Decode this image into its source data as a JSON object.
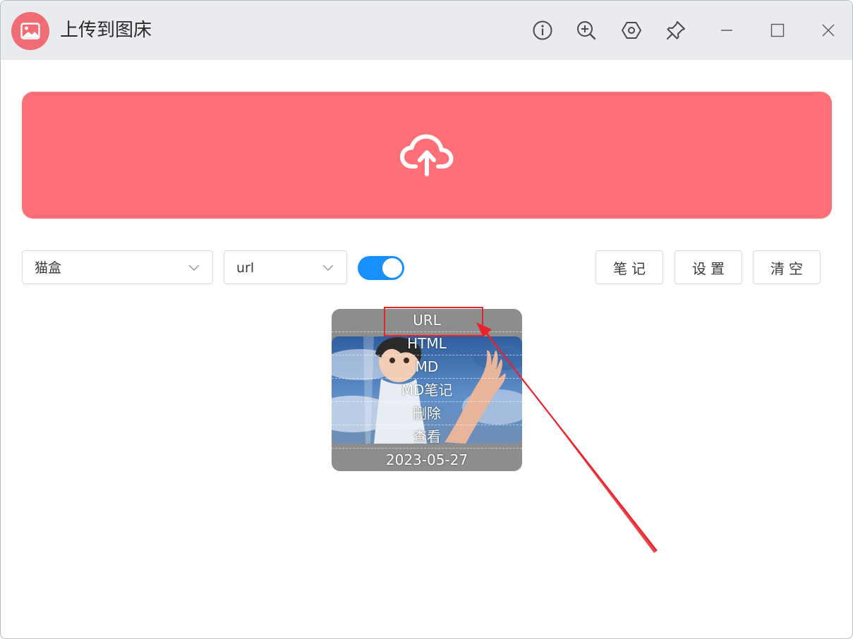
{
  "window": {
    "title": "上传到图床",
    "controls": [
      "info-icon",
      "zoom-in-icon",
      "settings-hex-icon",
      "pin-icon",
      "minimize-icon",
      "maximize-icon",
      "close-icon"
    ]
  },
  "toolbar": {
    "host_select": {
      "value": "猫盒"
    },
    "format_select": {
      "value": "url"
    },
    "toggle": {
      "on": true,
      "color": "#1890ff"
    },
    "buttons": {
      "notes": "笔记",
      "settings": "设置",
      "clear": "清空"
    }
  },
  "upload_area": {
    "icon": "cloud-upload-icon",
    "color": "#ff6f78"
  },
  "image_card": {
    "actions": [
      "URL",
      "HTML",
      "MD",
      "MD笔记",
      "删除",
      "查看"
    ],
    "date": "2023-05-27"
  },
  "annotation": {
    "color": "#e8232b"
  }
}
